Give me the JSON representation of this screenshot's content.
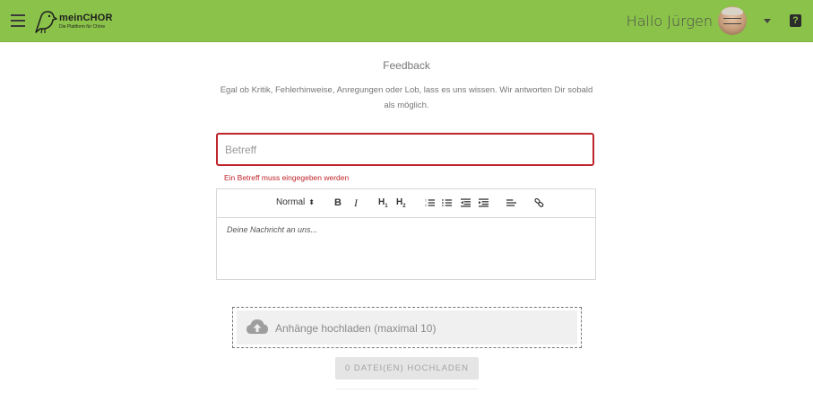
{
  "header": {
    "brand_name": "meinCHOR",
    "brand_tagline": "Die Plattform für Chöre",
    "greeting": "Hallo Jürgen",
    "help_label": "?",
    "accent_color": "#8bc34a"
  },
  "page": {
    "title": "Feedback",
    "intro": "Egal ob Kritik, Fehlerhinweise, Anregungen oder Lob, lass es uns wissen. Wir antworten Dir sobald als möglich."
  },
  "form": {
    "subject_placeholder": "Betreff",
    "subject_value": "",
    "subject_error": "Ein Betreff muss eingegeben werden",
    "error_color": "#c0242b",
    "editor": {
      "format_select": "Normal",
      "bold_label": "B",
      "italic_label": "I",
      "h1_label": "H",
      "h1_sub": "1",
      "h2_label": "H",
      "h2_sub": "2",
      "placeholder": "Deine Nachricht an uns..."
    },
    "dropzone_label": "Anhänge hochladen (maximal 10)",
    "upload_button": "0 DATEI(EN) HOCHLADEN"
  },
  "icons": [
    "menu-icon",
    "bird-logo-icon",
    "chevron-down-icon",
    "help-icon",
    "ordered-list-icon",
    "bullet-list-icon",
    "outdent-icon",
    "indent-icon",
    "align-icon",
    "link-icon",
    "cloud-upload-icon"
  ]
}
